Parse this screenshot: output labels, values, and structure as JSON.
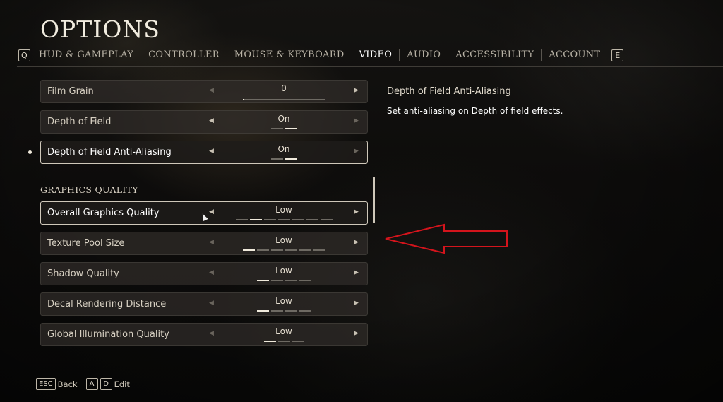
{
  "header": {
    "title": "OPTIONS"
  },
  "tabs": {
    "prev_key": "Q",
    "next_key": "E",
    "items": [
      "HUD & GAMEPLAY",
      "CONTROLLER",
      "MOUSE & KEYBOARD",
      "VIDEO",
      "AUDIO",
      "ACCESSIBILITY",
      "ACCOUNT"
    ],
    "active": "VIDEO"
  },
  "settings": {
    "film_grain": {
      "label": "Film Grain",
      "value": "0",
      "slider_fraction": 0.0
    },
    "depth_of_field": {
      "label": "Depth of Field",
      "value": "On",
      "segments_total": 2,
      "segments_active": 2
    },
    "dof_anti_aliasing": {
      "label": "Depth of Field Anti-Aliasing",
      "value": "On",
      "segments_total": 2,
      "segments_active": 2
    },
    "section_graphics": "GRAPHICS QUALITY",
    "overall_quality": {
      "label": "Overall Graphics Quality",
      "value": "Low",
      "segments_total": 7,
      "segments_active_index": 1
    },
    "texture_pool": {
      "label": "Texture Pool Size",
      "value": "Low",
      "segments_total": 6,
      "segments_active_index": 0
    },
    "shadow_quality": {
      "label": "Shadow Quality",
      "value": "Low",
      "segments_total": 4,
      "segments_active_index": 0
    },
    "decal_distance": {
      "label": "Decal Rendering Distance",
      "value": "Low",
      "segments_total": 4,
      "segments_active_index": 0
    },
    "global_illumination": {
      "label": "Global Illumination Quality",
      "value": "Low",
      "segments_total": 3,
      "segments_active_index": 0
    }
  },
  "description": {
    "title": "Depth of Field Anti-Aliasing",
    "text": "Set anti-aliasing on Depth of field effects."
  },
  "footer": {
    "back_key": "ESC",
    "back_label": "Back",
    "edit_key_a": "A",
    "edit_key_d": "D",
    "edit_label": "Edit"
  },
  "colors": {
    "accent": "#f0eadc",
    "annotation_arrow": "#d4141c",
    "row_bg": "#302d29"
  }
}
